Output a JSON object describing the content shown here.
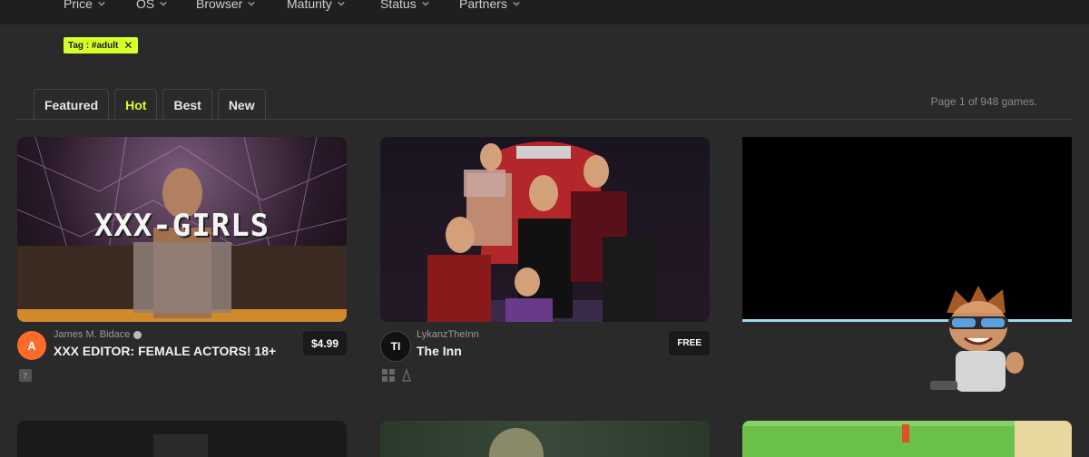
{
  "nav": {
    "filters": [
      {
        "label": "Price"
      },
      {
        "label": "OS"
      },
      {
        "label": "Browser"
      },
      {
        "label": "Maturity"
      },
      {
        "label": "Status"
      },
      {
        "label": "Partners"
      }
    ]
  },
  "active_tag": {
    "label": "Tag : #adult",
    "remove": "✕"
  },
  "tabs": [
    {
      "label": "Featured",
      "active": false
    },
    {
      "label": "Hot",
      "active": true
    },
    {
      "label": "Best",
      "active": false
    },
    {
      "label": "New",
      "active": false
    }
  ],
  "page_info": "Page 1 of 948 games.",
  "games": [
    {
      "author": "James M. Bidace",
      "title": "XXX EDITOR: FEMALE ACTORS! 18+",
      "price": "$4.99",
      "avatar_letter": "A",
      "thumb_text": "XXX-GIRLS"
    },
    {
      "author": "LykanzTheInn",
      "title": "The Inn",
      "price": "FREE",
      "avatar_letter": "TI"
    },
    {
      "author": "",
      "title": "",
      "price": ""
    }
  ],
  "colors": {
    "accent": "#d7ff2a",
    "bg": "#2a2a2a",
    "topbar": "#1f1f1f"
  }
}
